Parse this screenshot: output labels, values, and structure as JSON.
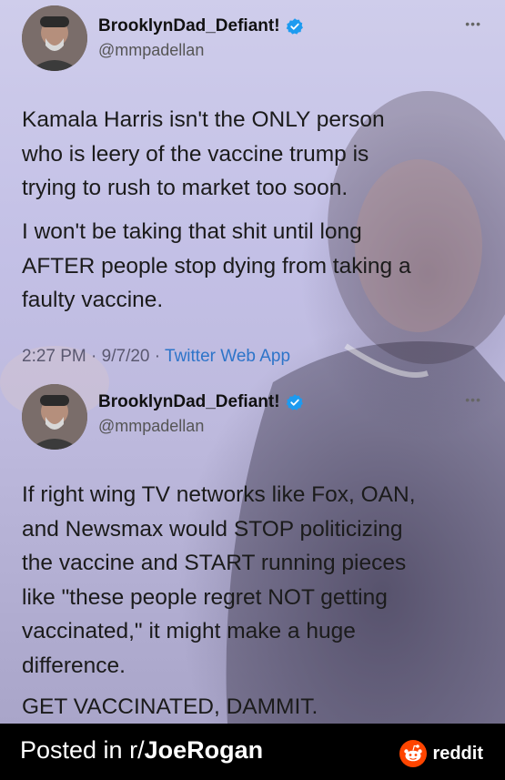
{
  "tweets": [
    {
      "display_name": "BrooklynDad_Defiant!",
      "handle": "@mmpadellan",
      "paragraphs": [
        [
          "Kamala Harris isn't the ONLY person",
          "who is leery of the vaccine trump is",
          "trying to rush to market too soon."
        ],
        [
          "I won't be taking that shit until long",
          "AFTER people stop dying from taking a",
          "faulty vaccine."
        ]
      ],
      "time": "2:27 PM",
      "date": "9/7/20",
      "source": "Twitter Web App"
    },
    {
      "display_name": "BrooklynDad_Defiant!",
      "handle": "@mmpadellan",
      "paragraphs": [
        [
          "If right wing TV networks like Fox, OAN,",
          "and Newsmax would STOP politicizing",
          "the vaccine and START running pieces",
          "like \"these people regret NOT getting",
          "vaccinated,\" it might make a huge",
          "difference."
        ],
        [
          "GET VACCINATED, DAMMIT."
        ]
      ]
    }
  ],
  "footer": {
    "posted_prefix": "Posted in r/",
    "subreddit": "JoeRogan",
    "brand": "reddit"
  },
  "colors": {
    "verified": "#1d9bf0",
    "link": "#2d74c9",
    "reddit_orange": "#ff4500"
  },
  "icons": [
    "verified-badge-icon",
    "more-dots-icon",
    "reddit-logo-icon"
  ]
}
